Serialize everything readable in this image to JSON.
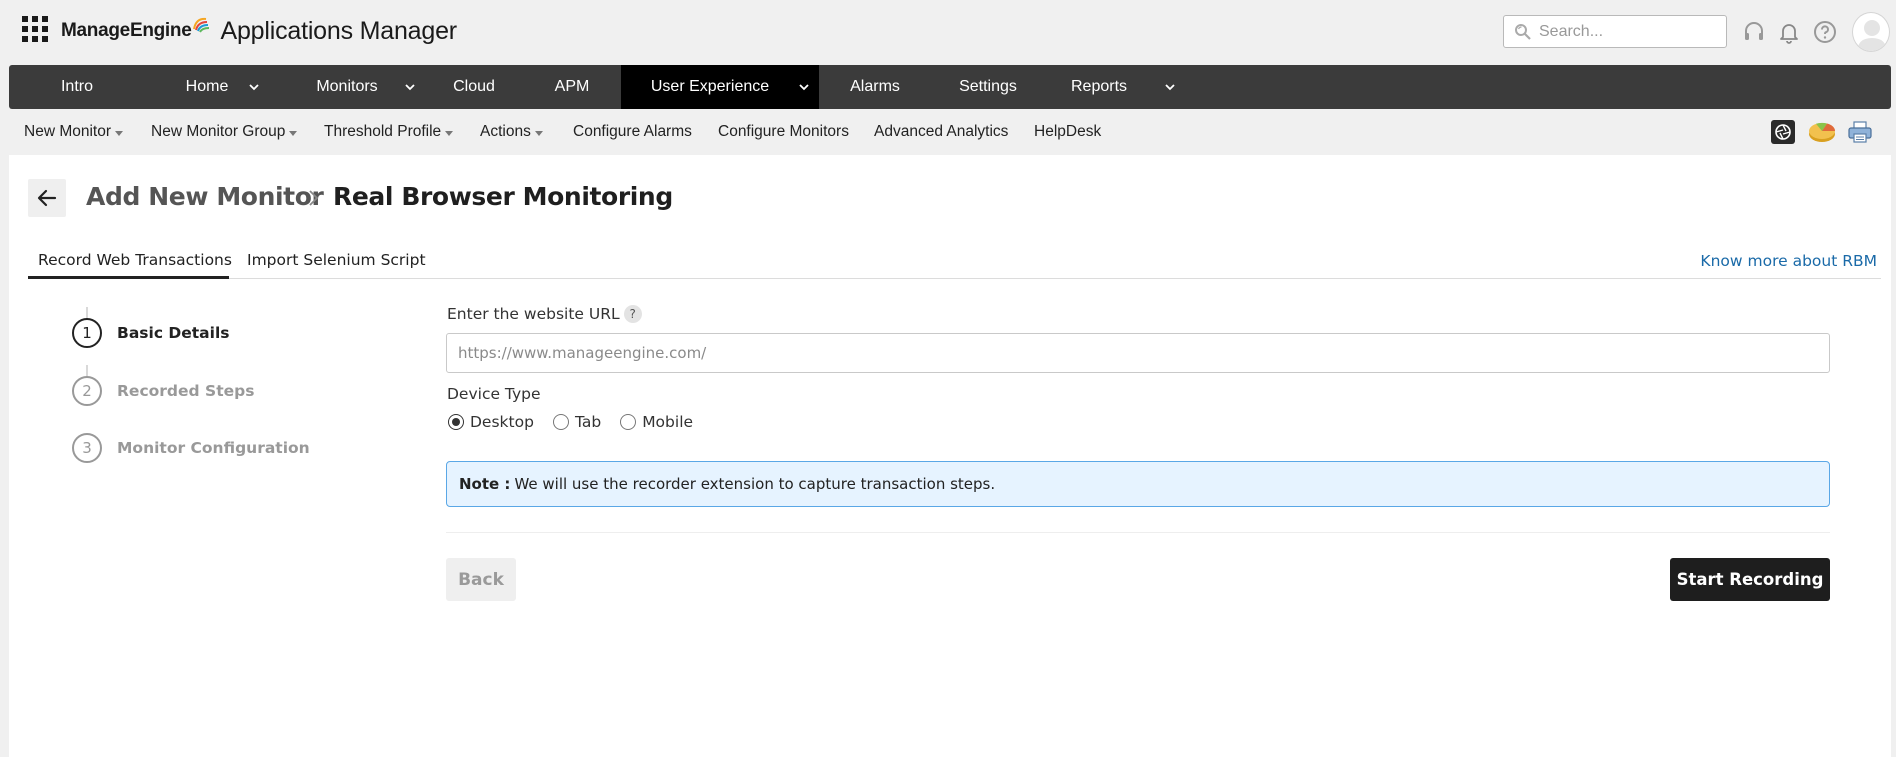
{
  "header": {
    "brand_name": "ManageEngine",
    "app_name": "Applications Manager",
    "search_placeholder": "Search..."
  },
  "main_nav": {
    "items": [
      {
        "label": "Intro",
        "has_menu": false
      },
      {
        "label": "Home",
        "has_menu": true
      },
      {
        "label": "Monitors",
        "has_menu": true
      },
      {
        "label": "Cloud",
        "has_menu": false
      },
      {
        "label": "APM",
        "has_menu": false
      },
      {
        "label": "User Experience",
        "has_menu": true,
        "active": true
      },
      {
        "label": "Alarms",
        "has_menu": false
      },
      {
        "label": "Settings",
        "has_menu": false
      },
      {
        "label": "Reports",
        "has_menu": true
      }
    ]
  },
  "sub_nav": {
    "items": [
      {
        "label": "New Monitor",
        "dropdown": true
      },
      {
        "label": "New Monitor Group",
        "dropdown": true
      },
      {
        "label": "Threshold Profile",
        "dropdown": true
      },
      {
        "label": "Actions",
        "dropdown": true
      },
      {
        "label": "Configure Alarms",
        "dropdown": false
      },
      {
        "label": "Configure Monitors",
        "dropdown": false
      },
      {
        "label": "Advanced Analytics",
        "dropdown": false
      },
      {
        "label": "HelpDesk",
        "dropdown": false
      }
    ],
    "tool_icons": [
      "camera-shutter-icon",
      "pie-chart-icon",
      "printer-icon"
    ]
  },
  "page": {
    "breadcrumb_parent": "Add New Monitor",
    "breadcrumb_current": "Real Browser Monitoring",
    "tabs": [
      {
        "label": "Record Web Transactions",
        "active": true
      },
      {
        "label": "Import Selenium Script",
        "active": false
      }
    ],
    "know_more_link": "Know more about RBM",
    "steps": [
      {
        "number": "1",
        "label": "Basic Details",
        "active": true
      },
      {
        "number": "2",
        "label": "Recorded Steps",
        "active": false
      },
      {
        "number": "3",
        "label": "Monitor Configuration",
        "active": false
      }
    ],
    "form": {
      "url_label": "Enter the website URL",
      "url_help": "?",
      "url_placeholder": "https://www.manageengine.com/",
      "url_value": "",
      "device_type_label": "Device Type",
      "device_options": [
        "Desktop",
        "Tab",
        "Mobile"
      ],
      "device_selected": "Desktop",
      "note_title": "Note :",
      "note_text": "We will use the recorder extension to capture transaction steps.",
      "back_button": "Back",
      "start_button": "Start Recording"
    }
  },
  "colors": {
    "nav_bg": "#3b3b3b",
    "nav_active_bg": "#000000",
    "link": "#1a6aa8",
    "note_bg": "#e6f3ff",
    "note_border": "#5aa7e6",
    "primary_button": "#1e1e1e"
  }
}
